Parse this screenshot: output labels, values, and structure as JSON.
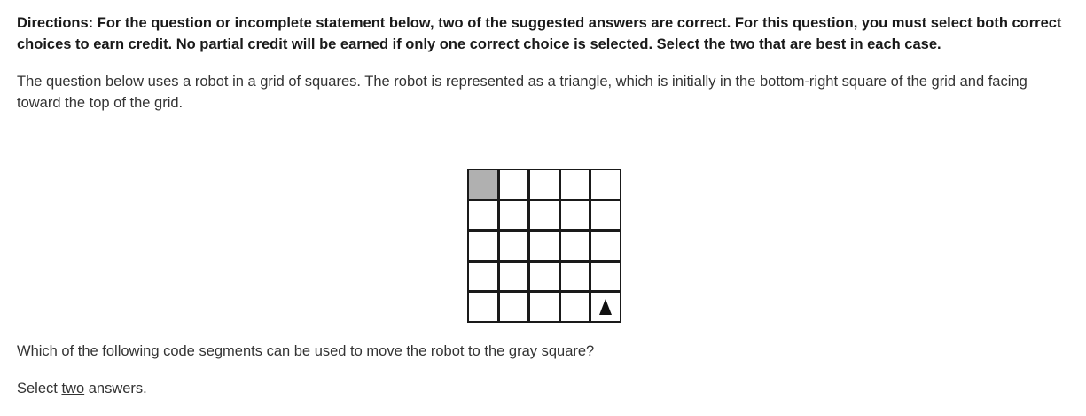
{
  "directions": "Directions: For the question or incomplete statement below, two of the suggested answers are correct. For this question, you must select both correct choices to earn credit. No partial credit will be earned if only one correct choice is selected. Select the two that are best in each case.",
  "intro": "The question below uses a robot in a grid of squares. The robot is represented as a triangle, which is initially in the bottom-right square of the grid and facing toward the top of the grid.",
  "grid": {
    "rows": 5,
    "cols": 5,
    "gray_cell": {
      "row": 1,
      "col": 1
    },
    "robot_cell": {
      "row": 5,
      "col": 5
    },
    "robot_facing": "up",
    "gray_color": "#b0b0b0"
  },
  "question": "Which of the following code segments can be used to move the robot to the gray square?",
  "instruction": {
    "prefix": "Select ",
    "emphasis": "two",
    "suffix": " answers."
  }
}
